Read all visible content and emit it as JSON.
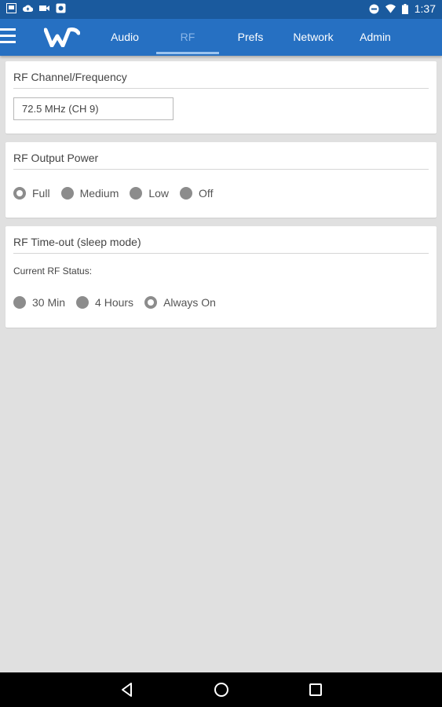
{
  "status_bar": {
    "time": "1:37"
  },
  "tabs": [
    {
      "label": "Audio",
      "active": false
    },
    {
      "label": "RF",
      "active": true
    },
    {
      "label": "Prefs",
      "active": false
    },
    {
      "label": "Network",
      "active": false
    },
    {
      "label": "Admin",
      "active": false
    }
  ],
  "rf_channel": {
    "title": "RF Channel/Frequency",
    "value": "72.5 MHz (CH 9)"
  },
  "rf_output_power": {
    "title": "RF Output Power",
    "options": [
      "Full",
      "Medium",
      "Low",
      "Off"
    ],
    "selected": "Full"
  },
  "rf_timeout": {
    "title": "RF Time-out (sleep mode)",
    "status_label": "Current RF Status:",
    "options": [
      "30 Min",
      "4 Hours",
      "Always On"
    ],
    "selected": "Always On"
  },
  "colors": {
    "status_bar": "#1a5a9e",
    "app_bar": "#2670c2",
    "active_tab": "#8ab6e8",
    "background": "#e0e0e0"
  }
}
